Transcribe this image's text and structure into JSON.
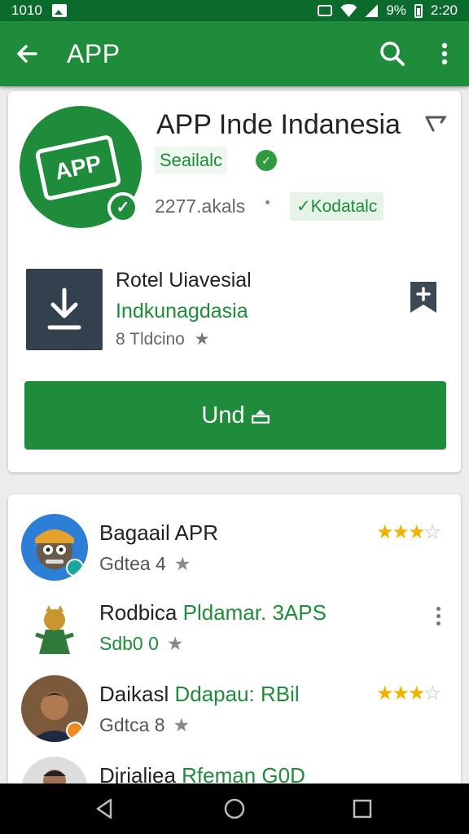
{
  "status_bar": {
    "left_text": "1010",
    "battery": "9%",
    "time": "2:20"
  },
  "app_bar": {
    "title": "APP",
    "icons": [
      "back-arrow-icon",
      "search-icon",
      "more-vert-icon"
    ]
  },
  "app": {
    "icon_text": "APP",
    "title": "APP Inde Indanesia",
    "developer": "Seailalc",
    "reviews": "2277.akals",
    "tag": "Kodatalc"
  },
  "promo": {
    "title": "Rotel Uiavesial",
    "subtitle": "Indkunagdasia",
    "meta_prefix": "8",
    "meta": "Tldcino"
  },
  "install_button": {
    "label": "Und"
  },
  "list": [
    {
      "name": "Bagaail APR",
      "name_green": "",
      "sub": "Gdtea 4",
      "rating": 2.5,
      "show_rating": true
    },
    {
      "name": "Rodbica",
      "name_green": "Pldamar. 3APS",
      "sub": "Sdb0 0",
      "sub_green": true,
      "show_menu": true
    },
    {
      "name": "Daikasl",
      "name_green": "Ddapau: RBil",
      "sub": "Gdtca 8",
      "rating": 2.5,
      "show_rating": true
    },
    {
      "name": "Djrialiea",
      "name_green": "Rfeman G0D",
      "sub": ""
    }
  ],
  "colors": {
    "status_bar": "#0b6b2d",
    "app_bar": "#1e8c3a",
    "accent": "#1e8c3a",
    "star": "#f0b400",
    "promo_thumb": "#33404d",
    "nav_bar": "#000000"
  }
}
